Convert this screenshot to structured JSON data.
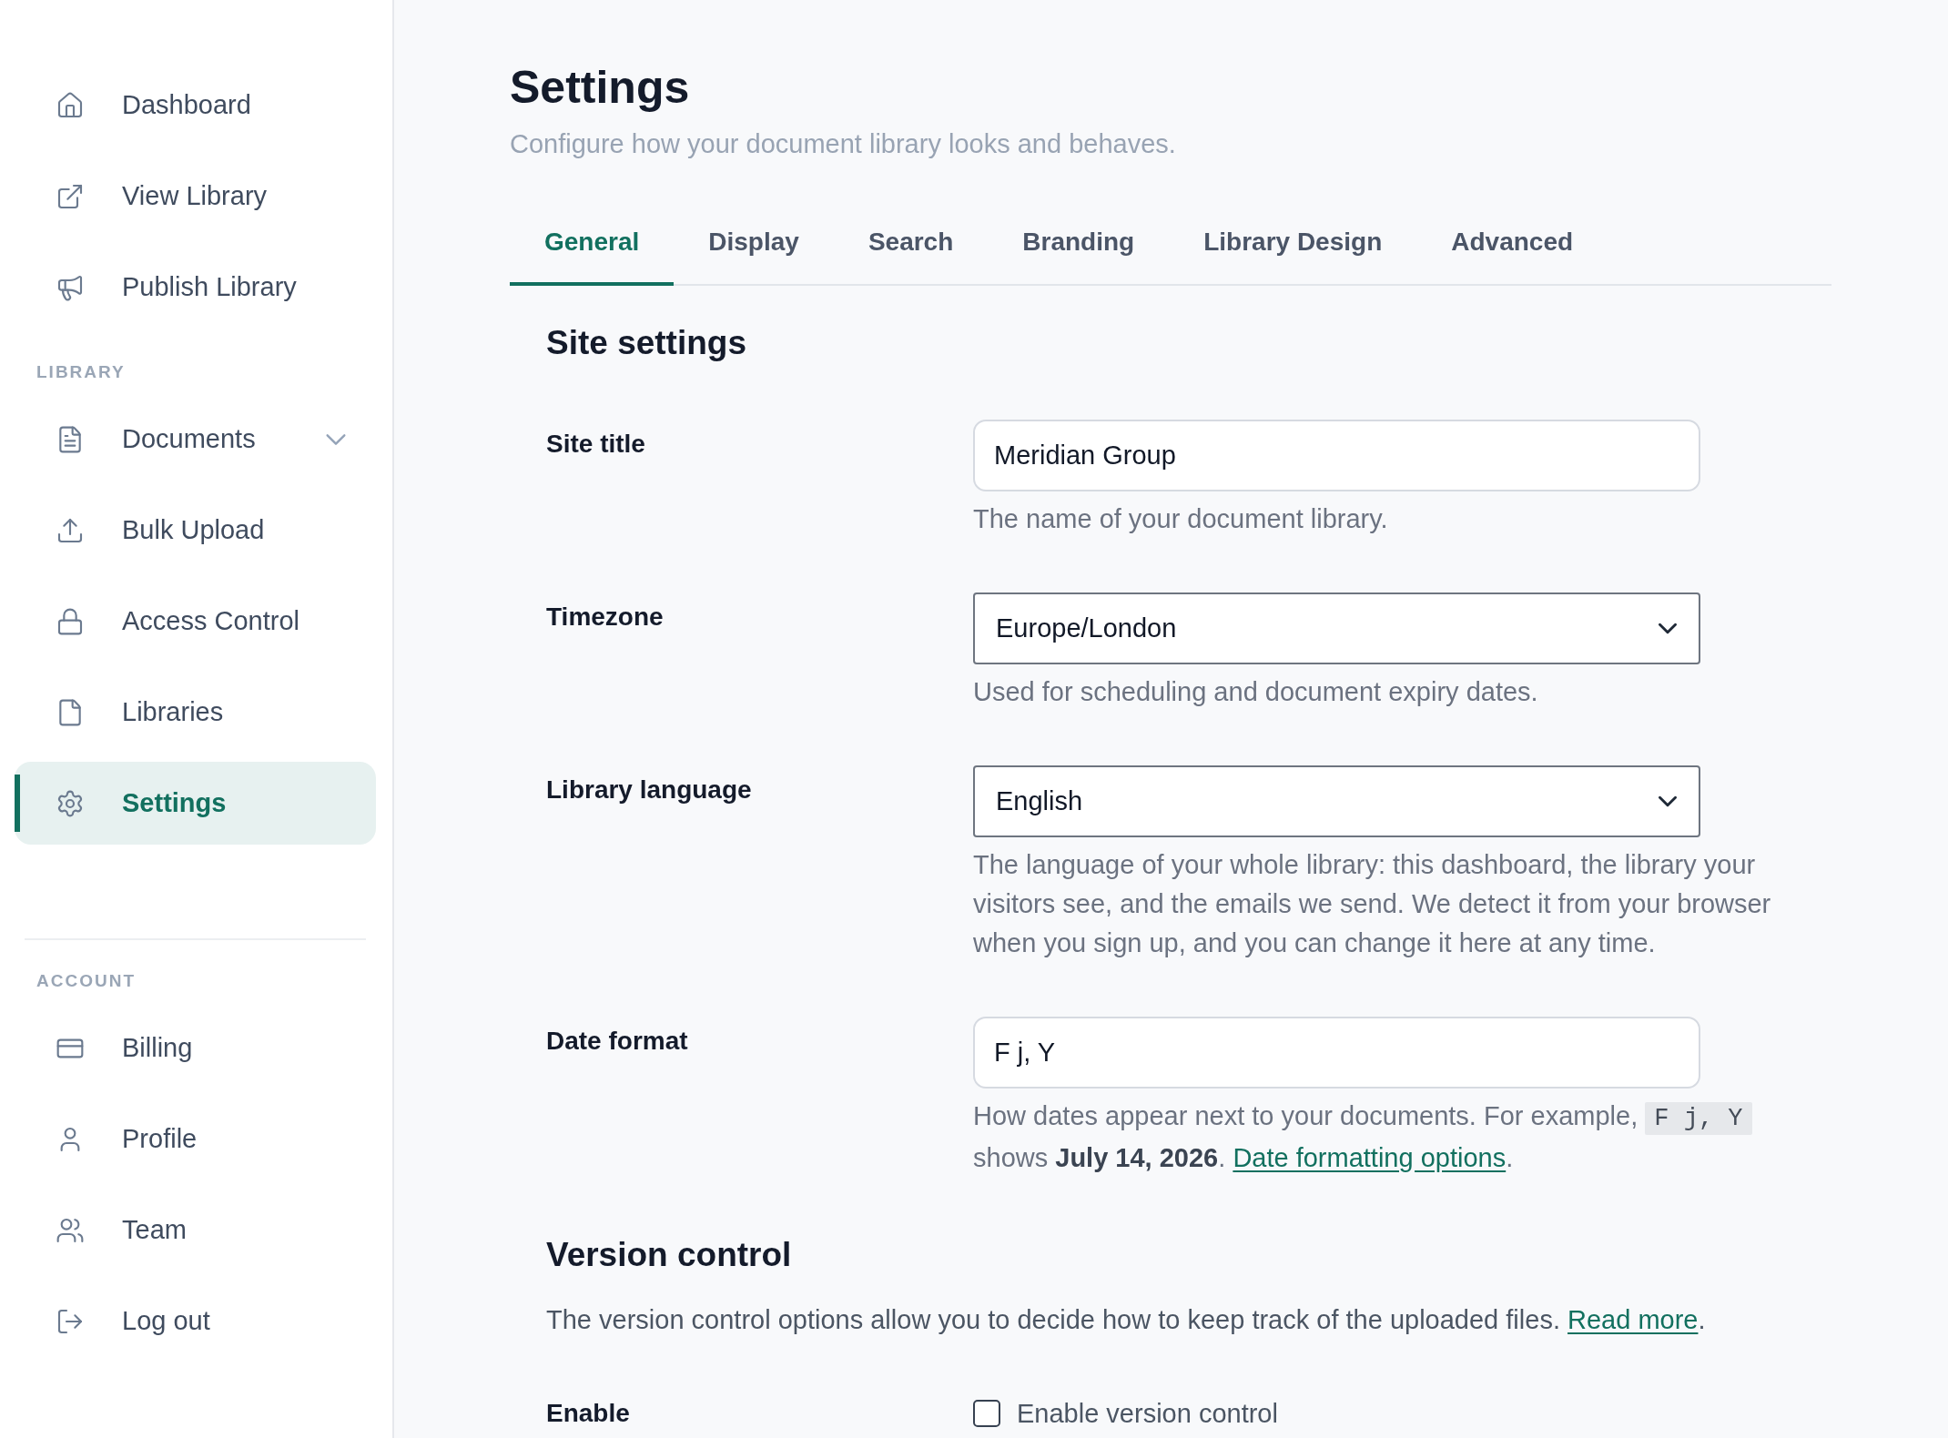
{
  "sidebar": {
    "items": [
      {
        "label": "Dashboard",
        "selected": false
      },
      {
        "label": "View Library",
        "selected": false
      },
      {
        "label": "Publish Library",
        "selected": false
      }
    ],
    "sections": [
      {
        "heading": "LIBRARY",
        "items": [
          {
            "kind": "menu",
            "label": "Documents",
            "selected": false,
            "expanded": false
          },
          {
            "kind": "link",
            "label": "Bulk Upload",
            "selected": false
          },
          {
            "kind": "link",
            "label": "Access Control",
            "selected": false
          },
          {
            "kind": "link",
            "label": "Libraries",
            "selected": false
          },
          {
            "kind": "link",
            "label": "Settings",
            "selected": true
          }
        ]
      },
      {
        "heading": "ACCOUNT",
        "items": [
          {
            "kind": "link",
            "label": "Billing",
            "selected": false
          },
          {
            "kind": "link",
            "label": "Profile",
            "selected": false
          },
          {
            "kind": "link",
            "label": "Team",
            "selected": false
          },
          {
            "kind": "link",
            "label": "Log out",
            "selected": false
          }
        ]
      }
    ]
  },
  "header": {
    "title": "Settings",
    "subtitle": "Configure how your document library looks and behaves."
  },
  "tabs": [
    {
      "label": "General",
      "selected": true
    },
    {
      "label": "Display",
      "selected": false
    },
    {
      "label": "Search",
      "selected": false
    },
    {
      "label": "Branding",
      "selected": false
    },
    {
      "label": "Library Design",
      "selected": false
    },
    {
      "label": "Advanced",
      "selected": false
    }
  ],
  "site_settings": {
    "heading": "Site settings",
    "fields": [
      {
        "kind": "text",
        "label": "Site title",
        "value": "Meridian Group",
        "help": [
          {
            "kind": "text",
            "text": "The name of your document library."
          }
        ]
      },
      {
        "kind": "select",
        "label": "Timezone",
        "value": "Europe/London",
        "help": [
          {
            "kind": "text",
            "text": "Used for scheduling and document expiry dates."
          }
        ]
      },
      {
        "kind": "select",
        "label": "Library language",
        "value": "English",
        "help": [
          {
            "kind": "text",
            "text": "The language of your whole library: this dashboard, the library your visitors see, and the emails we send. We detect it from your browser when you sign up, and you can change it here at any time."
          }
        ]
      },
      {
        "kind": "text",
        "label": "Date format",
        "value": "F j, Y",
        "help": [
          {
            "kind": "text",
            "text": "How dates appear next to your documents. For example, "
          },
          {
            "kind": "code",
            "text": "F j, Y"
          },
          {
            "kind": "text",
            "text": " shows **July 14, 2026**. "
          },
          {
            "kind": "link",
            "text": "Date formatting options"
          },
          {
            "kind": "text",
            "text": "."
          }
        ]
      }
    ]
  },
  "version_control": {
    "heading": "Version control",
    "description": [
      {
        "kind": "text",
        "text": "The version control options allow you to decide how to keep track of the uploaded files. "
      },
      {
        "kind": "link",
        "text": "Read more"
      },
      {
        "kind": "text",
        "text": "."
      }
    ],
    "fields": [
      {
        "kind": "checkbox",
        "label": "Enable",
        "option": "Enable version control",
        "checked": false
      }
    ]
  }
}
